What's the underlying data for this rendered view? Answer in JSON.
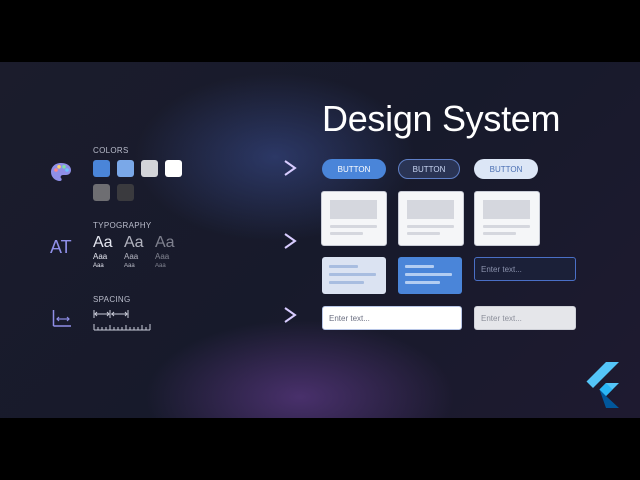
{
  "left": {
    "colors_label": "COLORS",
    "colors": [
      "#4a85d9",
      "#7aa8e8",
      "#d3d4d8",
      "#ffffff",
      "#6e6e72",
      "#3a3a3e"
    ],
    "typography_label": "TYPOGRAPHY",
    "typography_icon": "AT",
    "type_samples": [
      {
        "large": "Aa",
        "medium": "Aaa",
        "small": "Aaa"
      },
      {
        "large": "Aa",
        "medium": "Aaa",
        "small": "Aaa"
      },
      {
        "large": "Aa",
        "medium": "Aaa",
        "small": "Aaa"
      }
    ],
    "spacing_label": "SPACING"
  },
  "title": "Design System",
  "buttons": [
    {
      "label": "BUTTON",
      "style": "filled"
    },
    {
      "label": "BUTTON",
      "style": "outlined"
    },
    {
      "label": "BUTTON",
      "style": "light"
    }
  ],
  "inputs": {
    "outlined_dark_placeholder": "Enter text...",
    "white_placeholder": "Enter text...",
    "gray_placeholder": "Enter text..."
  },
  "accent": "#4a85d9",
  "arrow_color": "#b9a6f0"
}
